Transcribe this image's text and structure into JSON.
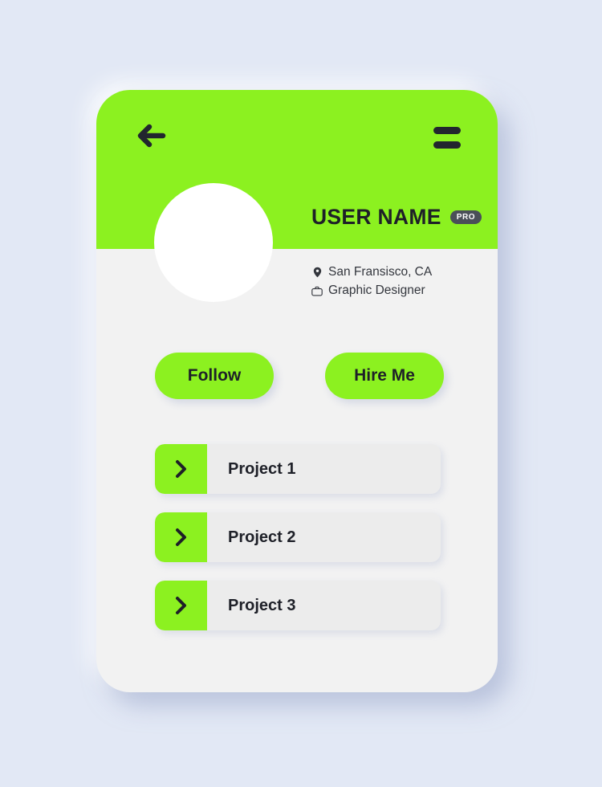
{
  "theme": {
    "page_background": "#e2e8f5",
    "card_background": "#f2f2f2",
    "accent_green": "#8cf120",
    "dark_text": "#1e2028",
    "row_track": "#ececec",
    "badge_background": "#4a4f58"
  },
  "header": {
    "back_icon": "arrow-left-icon",
    "menu_icon": "hamburger-menu-icon"
  },
  "profile": {
    "avatar": "user-avatar",
    "username": "USER NAME",
    "badge": "PRO",
    "location": {
      "icon": "map-pin-icon",
      "text": "San Fransisco, CA"
    },
    "occupation": {
      "icon": "briefcase-icon",
      "text": "Graphic Designer"
    }
  },
  "actions": {
    "follow_label": "Follow",
    "hire_label": "Hire Me"
  },
  "projects": {
    "chevron_icon": "chevron-right-icon",
    "items": [
      {
        "label": "Project 1"
      },
      {
        "label": "Project 2"
      },
      {
        "label": "Project 3"
      }
    ]
  }
}
